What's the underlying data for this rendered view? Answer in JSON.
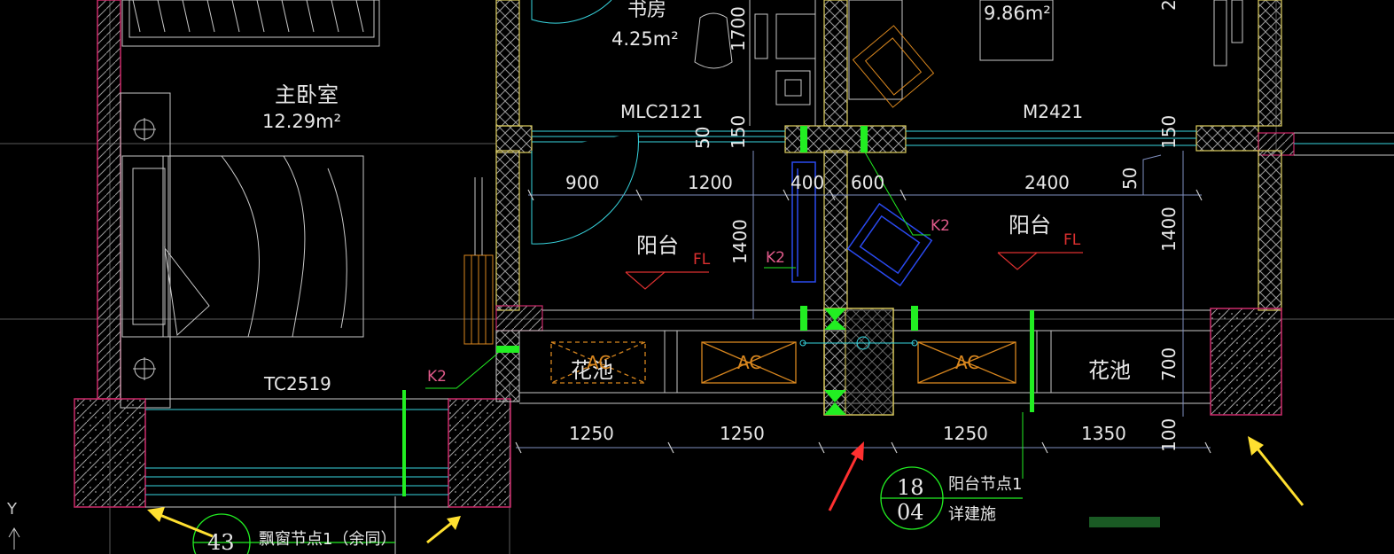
{
  "colors": {
    "background": "#000000",
    "wall": "#c8c8c8",
    "hatch_magenta": "#cc2a6a",
    "yellow": "#e0d060",
    "cyan": "#38d6e0",
    "green_bright": "#22ee22",
    "orange": "#d8861e",
    "red_label": "#dd3030",
    "pink_label": "#e05a8a",
    "blue": "#2a4af0",
    "dim_line": "#8090c0",
    "white_text": "#e8e8e8",
    "arrow_yellow": "#ffe030",
    "arrow_red": "#ff3030"
  },
  "rooms": {
    "master_bedroom": {
      "name": "主卧室",
      "area": "12.29m²"
    },
    "study": {
      "name": "书房",
      "area": "4.25m²"
    },
    "room_right": {
      "area": "9.86m²"
    },
    "balcony_left": {
      "name": "阳台",
      "floor": "FL"
    },
    "balcony_right": {
      "name": "阳台",
      "floor": "FL"
    },
    "planter_left": "花池",
    "planter_right": "花池"
  },
  "labels": {
    "door_left": "MLC2121",
    "door_right": "M2421",
    "window_bay": "TC2519",
    "ac_1": "AC",
    "ac_2": "AC",
    "ac_3": "AC",
    "k2_1": "K2",
    "k2_2": "K2",
    "k2_3": "K2",
    "axis_y": "Y"
  },
  "dimensions": {
    "top_row": [
      "900",
      "1200",
      "400",
      "600",
      "2400"
    ],
    "bottom_row": [
      "1250",
      "1250",
      "1250",
      "1350"
    ],
    "v_1700": "1700",
    "v_50a": "50",
    "v_150a": "150",
    "v_1400a": "1400",
    "v_150b": "150",
    "v_50b": "50",
    "v_1400b": "1400",
    "v_700": "700",
    "v_100": "100",
    "v_2_top": "2"
  },
  "callouts": {
    "balcony_node": {
      "top": "18",
      "bottom": "04",
      "title": "阳台节点1",
      "sub": "详建施"
    },
    "bay_window_node": {
      "number": "43",
      "title": "飘窗节点1（余同）"
    }
  }
}
